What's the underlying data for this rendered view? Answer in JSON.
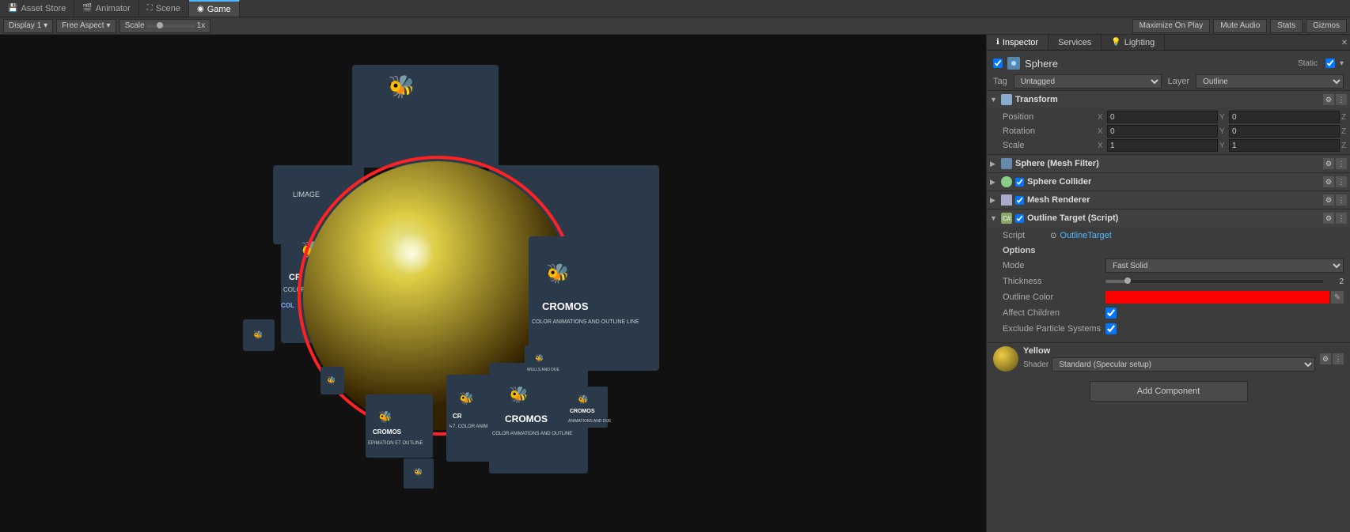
{
  "tabs": [
    {
      "id": "asset-store",
      "label": "Asset Store",
      "icon": "💾",
      "active": false
    },
    {
      "id": "animator",
      "label": "Animator",
      "icon": "🎬",
      "active": false
    },
    {
      "id": "scene",
      "label": "Scene",
      "icon": "⛶",
      "active": false
    },
    {
      "id": "game",
      "label": "Game",
      "icon": "◉",
      "active": true
    }
  ],
  "toolbar": {
    "display_label": "Display 1",
    "aspect_label": "Free Aspect",
    "scale_label": "Scale",
    "scale_value": "1x",
    "maximize_label": "Maximize On Play",
    "mute_label": "Mute Audio",
    "stats_label": "Stats",
    "gizmos_label": "Gizmos"
  },
  "inspector": {
    "tabs": [
      {
        "id": "inspector",
        "label": "Inspector",
        "active": true
      },
      {
        "id": "services",
        "label": "Services",
        "active": false
      },
      {
        "id": "lighting",
        "label": "Lighting",
        "active": false
      }
    ],
    "object": {
      "name": "Sphere",
      "enabled": true,
      "static": "Static",
      "static_checked": true
    },
    "tag": {
      "label": "Tag",
      "value": "Untagged"
    },
    "layer": {
      "label": "Layer",
      "value": "Outline"
    },
    "transform": {
      "title": "Transform",
      "position": {
        "label": "Position",
        "x": "0",
        "y": "0",
        "z": "0"
      },
      "rotation": {
        "label": "Rotation",
        "x": "0",
        "y": "0",
        "z": "0"
      },
      "scale": {
        "label": "Scale",
        "x": "1",
        "y": "1",
        "z": "1"
      }
    },
    "sphere_mesh_filter": {
      "title": "Sphere (Mesh Filter)",
      "enabled": false
    },
    "sphere_collider": {
      "title": "Sphere Collider",
      "enabled": true
    },
    "mesh_renderer": {
      "title": "Mesh Renderer",
      "enabled": true
    },
    "outline_target": {
      "title": "Outline Target (Script)",
      "enabled": true,
      "script_label": "Script",
      "script_value": "OutlineTarget",
      "options": {
        "title": "Options",
        "mode": {
          "label": "Mode",
          "value": "Fast Solid"
        },
        "thickness": {
          "label": "Thickness",
          "value": "2",
          "slider_pct": 10
        },
        "outline_color": {
          "label": "Outline Color",
          "color": "#ff0000"
        },
        "affect_children": {
          "label": "Affect Children",
          "checked": true
        },
        "exclude_particles": {
          "label": "Exclude Particle Systems",
          "checked": true
        }
      }
    },
    "material": {
      "name": "Yellow",
      "shader_label": "Shader",
      "shader_value": "Standard (Specular setup)"
    },
    "add_component_label": "Add Component"
  }
}
